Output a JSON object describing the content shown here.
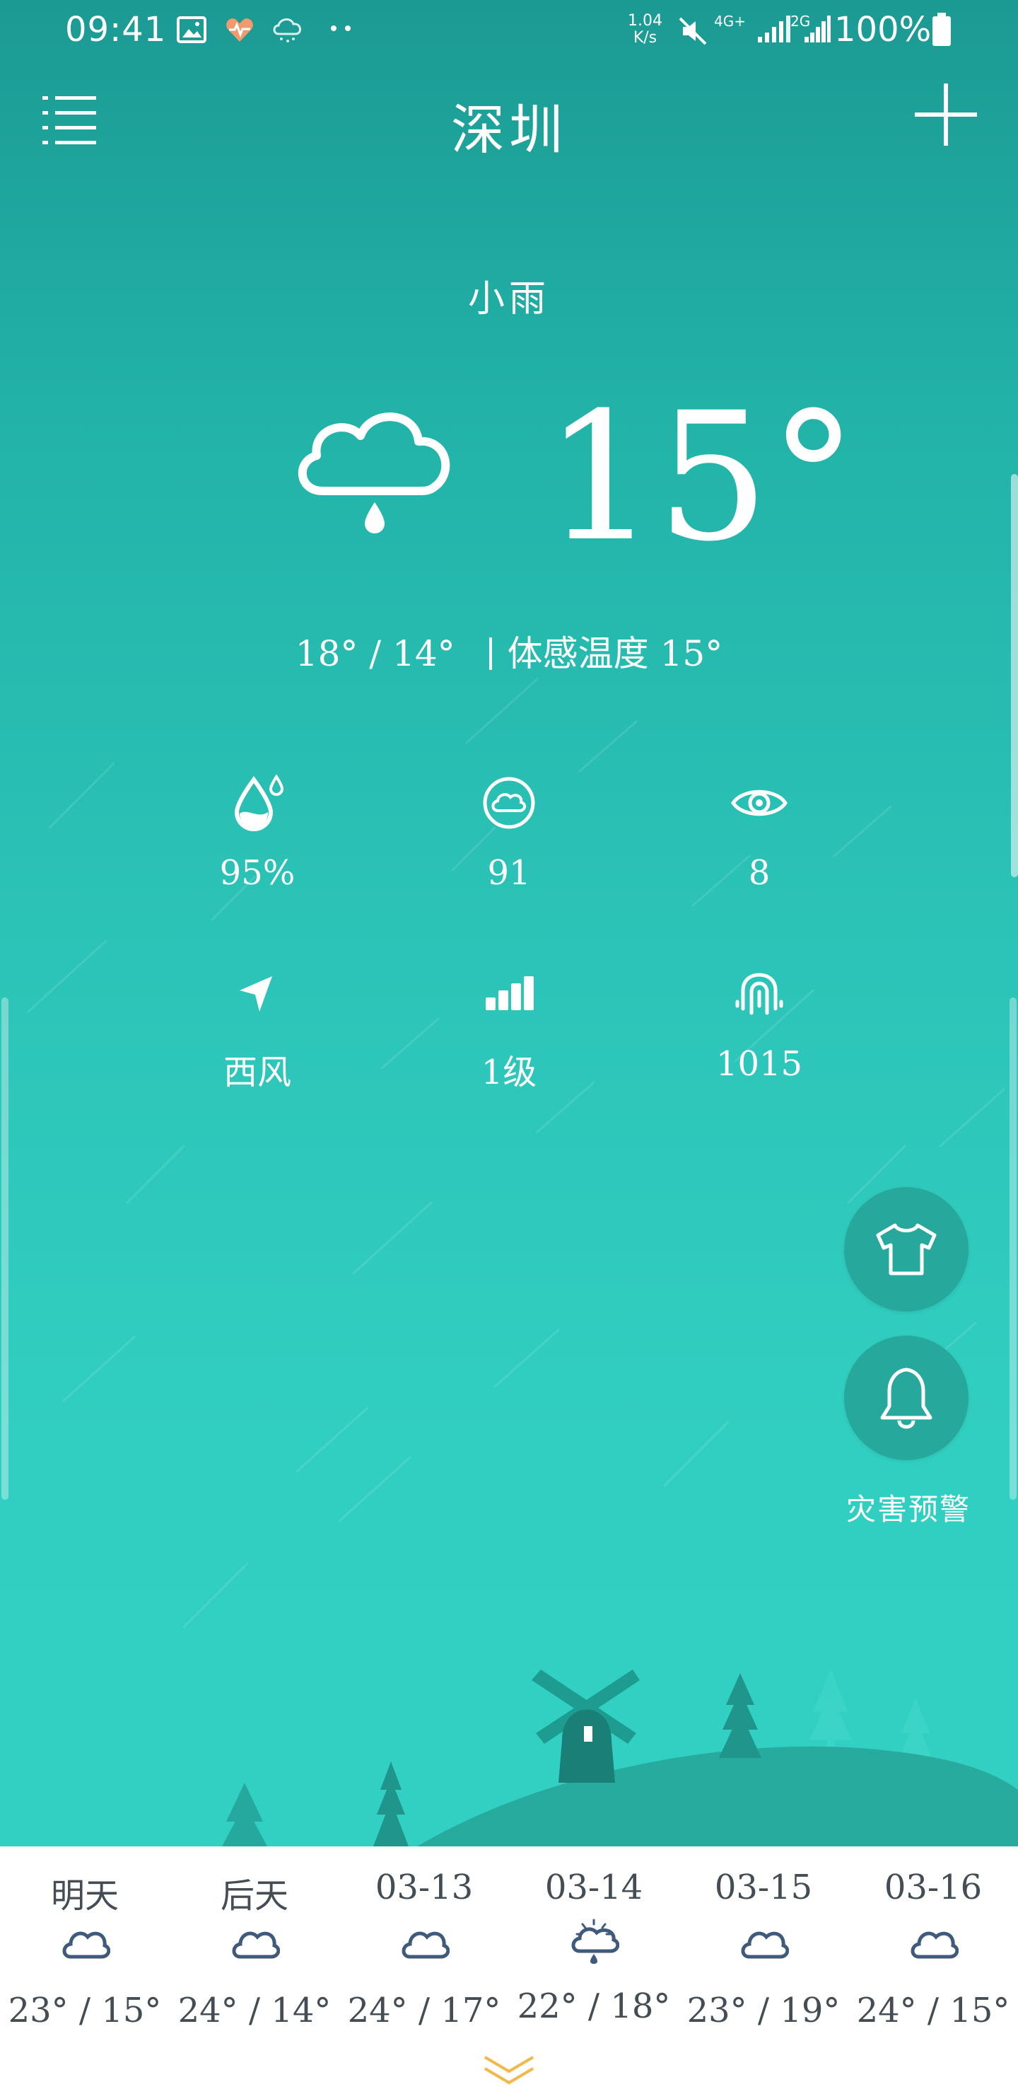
{
  "status_bar": {
    "time": "09:41",
    "net_speed_top": "1.04",
    "net_speed_bottom": "K/s",
    "network_label": "4G+",
    "network2_label": "2G",
    "battery": "100%",
    "icons": [
      "image-icon",
      "heart-rate-icon",
      "weather-rain-icon",
      "more-dots-icon",
      "mute-icon",
      "signal-icon",
      "battery-icon"
    ]
  },
  "header": {
    "city": "深圳",
    "menu_icon": "list-menu-icon",
    "add_icon": "plus-icon"
  },
  "current": {
    "condition": "小雨",
    "temperature": "15°",
    "high_low": "18° / 14°",
    "feels_like": "体感温度  15°",
    "icon": "cloud-rain-icon"
  },
  "details": [
    {
      "icon": "humidity-icon",
      "value": "95%"
    },
    {
      "icon": "air-quality-icon",
      "value": "91"
    },
    {
      "icon": "visibility-icon",
      "value": "8"
    },
    {
      "icon": "wind-direction-icon",
      "value": "西风"
    },
    {
      "icon": "wind-level-icon",
      "value": "1级"
    },
    {
      "icon": "pressure-icon",
      "value": "1015"
    }
  ],
  "actions": {
    "clothing_icon": "shirt-icon",
    "alert_icon": "bell-icon",
    "alert_label": "灾害预警"
  },
  "forecast": [
    {
      "label": "明天",
      "range": "23° / 15°",
      "icon": "cloud-icon"
    },
    {
      "label": "后天",
      "range": "24° / 14°",
      "icon": "cloud-icon"
    },
    {
      "label": "03-13",
      "range": "24° / 17°",
      "icon": "cloud-icon"
    },
    {
      "label": "03-14",
      "range": "22° / 18°",
      "icon": "sun-cloud-rain-icon"
    },
    {
      "label": "03-15",
      "range": "23° / 19°",
      "icon": "cloud-icon"
    },
    {
      "label": "03-16",
      "range": "24° / 15°",
      "icon": "cloud-icon"
    }
  ],
  "colors": {
    "sky_top": "#1b9a93",
    "sky_bottom": "#32d0c2",
    "fab": "#26a89d",
    "hill": "#27ab9f",
    "forecast_icon": "#3f5a7a"
  }
}
